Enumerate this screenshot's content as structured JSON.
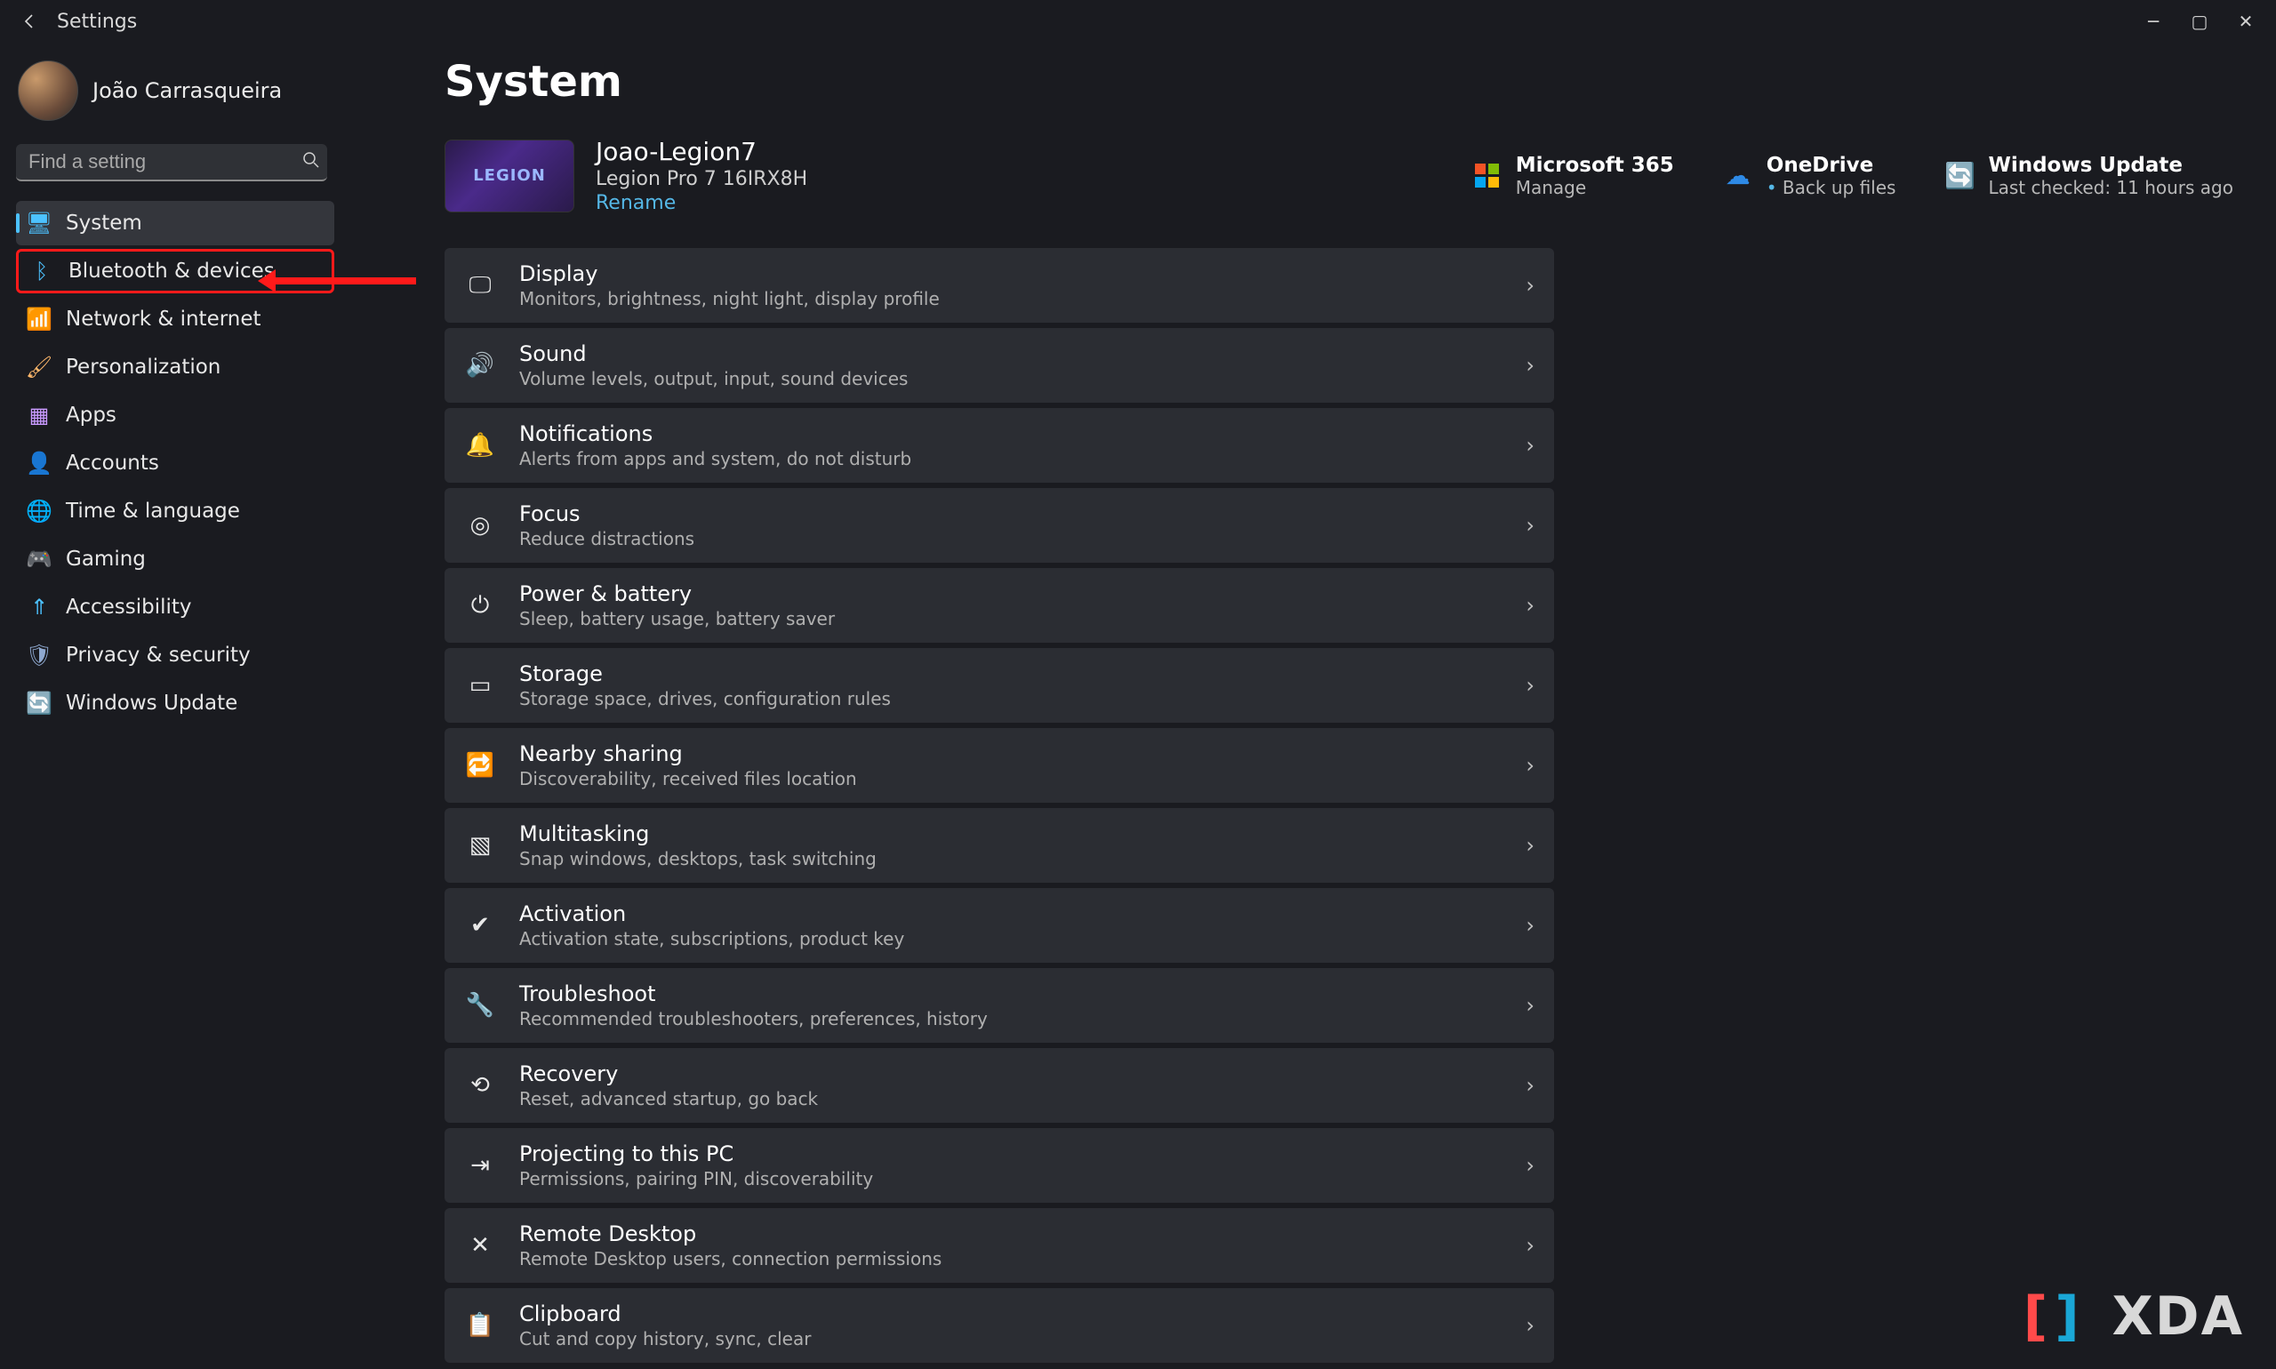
{
  "window": {
    "title": "Settings"
  },
  "account": {
    "displayName": "João Carrasqueira"
  },
  "search": {
    "placeholder": "Find a setting"
  },
  "sidebar": {
    "items": [
      {
        "label": "System",
        "icon": "display-icon",
        "active": true
      },
      {
        "label": "Bluetooth & devices",
        "icon": "bluetooth-icon",
        "highlight": true
      },
      {
        "label": "Network & internet",
        "icon": "wifi-icon"
      },
      {
        "label": "Personalization",
        "icon": "paintbrush-icon"
      },
      {
        "label": "Apps",
        "icon": "apps-icon"
      },
      {
        "label": "Accounts",
        "icon": "person-icon"
      },
      {
        "label": "Time & language",
        "icon": "globe-clock-icon"
      },
      {
        "label": "Gaming",
        "icon": "gamepad-icon"
      },
      {
        "label": "Accessibility",
        "icon": "accessibility-icon"
      },
      {
        "label": "Privacy & security",
        "icon": "shield-icon"
      },
      {
        "label": "Windows Update",
        "icon": "update-icon"
      }
    ]
  },
  "page": {
    "title": "System",
    "device": {
      "name": "Joao-Legion7",
      "model": "Legion Pro 7 16IRX8H",
      "renameLabel": "Rename",
      "thumbText": "LEGION"
    },
    "status": [
      {
        "title": "Microsoft 365",
        "sub": "Manage",
        "icon": "m365-icon"
      },
      {
        "title": "OneDrive",
        "sub": "Back up files",
        "icon": "cloud-icon",
        "bullet": true
      },
      {
        "title": "Windows Update",
        "sub": "Last checked: 11 hours ago",
        "icon": "update-icon"
      }
    ],
    "items": [
      {
        "title": "Display",
        "sub": "Monitors, brightness, night light, display profile",
        "icon": "display-icon"
      },
      {
        "title": "Sound",
        "sub": "Volume levels, output, input, sound devices",
        "icon": "speaker-icon"
      },
      {
        "title": "Notifications",
        "sub": "Alerts from apps and system, do not disturb",
        "icon": "bell-icon"
      },
      {
        "title": "Focus",
        "sub": "Reduce distractions",
        "icon": "focus-icon"
      },
      {
        "title": "Power & battery",
        "sub": "Sleep, battery usage, battery saver",
        "icon": "power-icon"
      },
      {
        "title": "Storage",
        "sub": "Storage space, drives, configuration rules",
        "icon": "storage-icon"
      },
      {
        "title": "Nearby sharing",
        "sub": "Discoverability, received files location",
        "icon": "share-icon"
      },
      {
        "title": "Multitasking",
        "sub": "Snap windows, desktops, task switching",
        "icon": "multitask-icon"
      },
      {
        "title": "Activation",
        "sub": "Activation state, subscriptions, product key",
        "icon": "check-icon"
      },
      {
        "title": "Troubleshoot",
        "sub": "Recommended troubleshooters, preferences, history",
        "icon": "wrench-icon"
      },
      {
        "title": "Recovery",
        "sub": "Reset, advanced startup, go back",
        "icon": "recovery-icon"
      },
      {
        "title": "Projecting to this PC",
        "sub": "Permissions, pairing PIN, discoverability",
        "icon": "project-icon"
      },
      {
        "title": "Remote Desktop",
        "sub": "Remote Desktop users, connection permissions",
        "icon": "remote-icon"
      },
      {
        "title": "Clipboard",
        "sub": "Cut and copy history, sync, clear",
        "icon": "clipboard-icon"
      }
    ]
  },
  "watermark": "XDA"
}
